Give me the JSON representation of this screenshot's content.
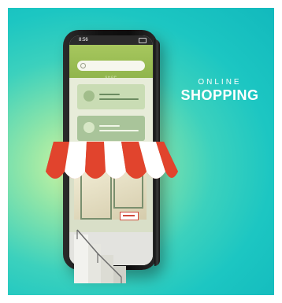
{
  "brand": {
    "line1": "ONLINE",
    "line2": "SHOPPING"
  },
  "phone": {
    "status_time": "8:56",
    "header_tagline": "SHOP"
  },
  "colors": {
    "background_center": "#d9f7a0",
    "background_outer": "#12b9bd",
    "awning_red": "#e1442d",
    "awning_white": "#ffffff",
    "header_green": "#a7c75e"
  },
  "icons": [
    "search-icon",
    "avatar-icon",
    "battery-icon"
  ]
}
